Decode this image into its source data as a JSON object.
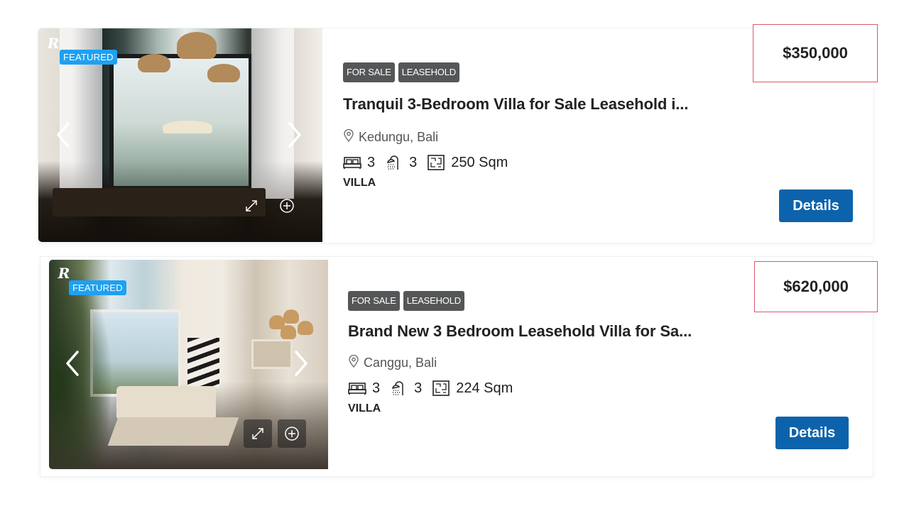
{
  "listings": [
    {
      "featured_label": "FEATURED",
      "logo_text": "R",
      "tags": [
        "FOR SALE",
        "LEASEHOLD"
      ],
      "title": "Tranquil 3-Bedroom Villa for Sale Leasehold i...",
      "location": "Kedungu, Bali",
      "bedrooms": "3",
      "bathrooms": "3",
      "area": "250 Sqm",
      "type": "VILLA",
      "price": "$350,000",
      "details_label": "Details"
    },
    {
      "featured_label": "FEATURED",
      "logo_text": "R",
      "tags": [
        "FOR SALE",
        "LEASEHOLD"
      ],
      "title": "Brand New 3 Bedroom Leasehold Villa for Sa...",
      "location": "Canggu, Bali",
      "bedrooms": "3",
      "bathrooms": "3",
      "area": "224 Sqm",
      "type": "VILLA",
      "price": "$620,000",
      "details_label": "Details"
    }
  ],
  "colors": {
    "featured": "#1da1f2",
    "tag": "#555657",
    "details_button": "#0d63ab",
    "price_border": "#e0566a"
  },
  "icons": {
    "location": "map-pin-icon",
    "bedrooms": "bed-icon",
    "bathrooms": "shower-icon",
    "area": "floor-plan-icon",
    "prev": "chevron-left-icon",
    "next": "chevron-right-icon",
    "expand": "expand-icon",
    "add": "plus-circle-icon"
  }
}
